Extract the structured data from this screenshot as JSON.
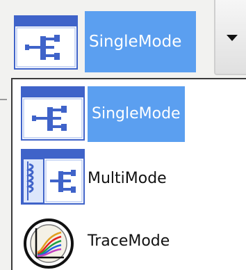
{
  "combo": {
    "selected_label": "SingleMode",
    "selected_icon": "single-mode-icon",
    "arrow_icon": "dropdown-arrow-icon"
  },
  "options": [
    {
      "label": "SingleMode",
      "icon": "single-mode-icon",
      "selected": true
    },
    {
      "label": "MultiMode",
      "icon": "multi-mode-icon",
      "selected": false
    },
    {
      "label": "TraceMode",
      "icon": "trace-mode-icon",
      "selected": false
    }
  ],
  "colors": {
    "selection": "#5b9ff0",
    "icon_blue": "#3f63c9",
    "icon_light": "#dce6fb"
  }
}
